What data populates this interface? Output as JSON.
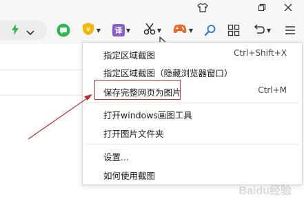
{
  "menu": {
    "items": [
      {
        "label": "指定区域截图",
        "shortcut": "Ctrl+Shift+X"
      },
      {
        "label": "指定区域截图（隐藏浏览器窗口）",
        "shortcut": ""
      },
      {
        "label": "保存完整网页为图片",
        "shortcut": "Ctrl+M"
      },
      {
        "label": "打开windows画图工具",
        "shortcut": ""
      },
      {
        "label": "打开图片文件夹",
        "shortcut": ""
      },
      {
        "label": "设置...",
        "shortcut": ""
      },
      {
        "label": "如何使用截图",
        "shortcut": ""
      }
    ]
  },
  "toolbar": {
    "translate_label": "译"
  },
  "icons": {
    "shirt": "shirt-icon",
    "restore": "restore-icon",
    "close": "close-icon",
    "lightning": "lightning-icon",
    "chat": "chat-icon",
    "wallet": "wallet-icon",
    "translate": "translate-icon",
    "scissors": "scissors-icon",
    "gamepad": "gamepad-icon",
    "search": "search-icon",
    "grid": "grid-icon",
    "undo": "undo-icon",
    "menu": "menu-icon"
  },
  "colors": {
    "highlight": "#d32f2f",
    "arrow": "#c62828",
    "chat_green": "#2fb84b",
    "wallet_yellow": "#f2b705",
    "translate_purple": "#8a5cd6",
    "gamepad_orange": "#e86a2a",
    "search_blue": "#2f7fe0"
  },
  "watermark": "Baidu经验"
}
